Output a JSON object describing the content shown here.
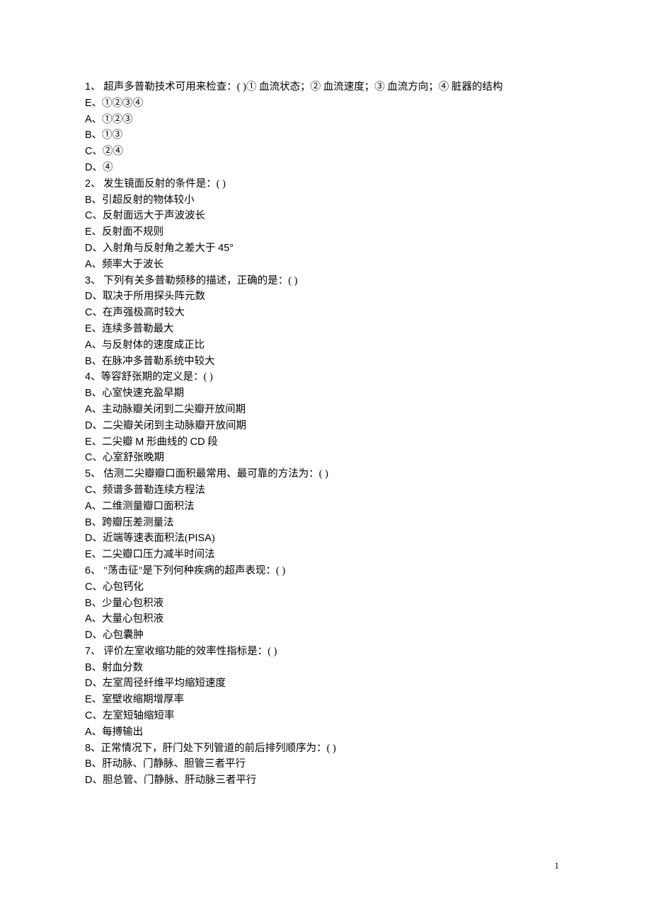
{
  "lines": [
    "1、 超声多普勒技术可用来检查：( )① 血流状态；② 血流速度；③ 血流方向；④ 脏器的结构",
    "E、①②③④",
    "A、①②③",
    "B、①③",
    "C、②④",
    "D、④",
    "2、 发生镜面反射的条件是：( )",
    "B、引超反射的物体较小",
    "C、反射面远大于声波波长",
    "E、反射面不规则",
    "D、入射角与反射角之差大于 45°",
    "A、频率大于波长",
    "3、 下列有关多普勒频移的描述，正确的是：( )",
    "D、取决于所用探头阵元数",
    "C、在声强极高时较大",
    "E、连续多普勒最大",
    "A、与反射体的速度成正比",
    "B、在脉冲多普勒系统中较大",
    "4、等容舒张期的定义是：( )",
    "B、心室快速充盈早期",
    "A、主动脉瓣关闭到二尖瓣开放间期",
    "D、二尖瓣关闭到主动脉瓣开放间期",
    "E、二尖瓣 M 形曲线的 CD 段",
    "C、心室舒张晚期",
    "5、 估测二尖瓣瓣口面积最常用、最可靠的方法为：( )",
    "C、频谱多普勒连续方程法",
    "A、二维测量瓣口面积法",
    "B、跨瓣压差测量法",
    "D、近端等速表面积法(PISA)",
    "E、二尖瓣口压力减半时间法",
    "6、 \"荡击征\"是下列何种疾病的超声表现：( )",
    "C、心包钙化",
    "B、少量心包积液",
    "A、大量心包积液",
    "D、心包囊肿",
    "7、 评价左室收缩功能的效率性指标是：( )",
    "B、射血分数",
    "D、左室周径纤维平均缩短速度",
    "E、室壁收缩期增厚率",
    "C、左室短轴缩短率",
    "A、每搏输出",
    "8、正常情况下，肝门处下列管道的前后排列顺序为：( )",
    "B、肝动脉、门静脉、胆管三者平行",
    "D、胆总管、门静脉、肝动脉三者平行"
  ],
  "page_number": "1"
}
